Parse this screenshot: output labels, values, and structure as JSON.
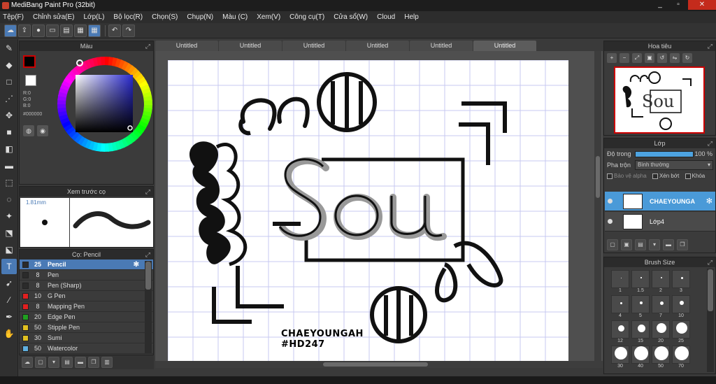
{
  "window": {
    "title": "MediBang Paint Pro (32bit)",
    "min": "_",
    "max": "▫",
    "close": "✕"
  },
  "menu": [
    "Tệp(F)",
    "Chỉnh sửa(E)",
    "Lớp(L)",
    "Bộ lọc(R)",
    "Chọn(S)",
    "Chụp(N)",
    "Màu (C)",
    "Xem(V)",
    "Công cụ(T)",
    "Cửa sổ(W)",
    "Cloud",
    "Help"
  ],
  "toolbar_icons": [
    "cloud-icon",
    "export-icon",
    "chat-icon",
    "comment-icon",
    "page-icon",
    "grid-icon",
    "grid-active-icon",
    "undo-icon",
    "redo-icon"
  ],
  "tools": [
    "brush-icon",
    "eraser-icon",
    "rectangle-icon",
    "dotbrush-icon",
    "move-icon",
    "fill-rect-icon",
    "bucket-icon",
    "gradient-icon",
    "select-rect-icon",
    "lasso-icon",
    "wand-icon",
    "selpen-icon",
    "selerase-icon",
    "text-icon",
    "operation-icon",
    "eyedropper-icon",
    "pen-icon",
    "hand-icon"
  ],
  "color_panel": {
    "title": "Màu",
    "r": "R:0",
    "g": "G:0",
    "b": "B:0",
    "hex": "#000000",
    "main_color": "#000000",
    "accent_border": "#cc0000"
  },
  "preview_panel": {
    "title": "Xem trước cọ",
    "size": "1.81mm"
  },
  "brush_panel": {
    "title": "Cọ: Pencil",
    "brushes": [
      {
        "size": "25",
        "name": "Pencil",
        "color": "#2b2b2b",
        "selected": true
      },
      {
        "size": "8",
        "name": "Pen",
        "color": "#2b2b2b",
        "selected": false
      },
      {
        "size": "8",
        "name": "Pen (Sharp)",
        "color": "#2b2b2b",
        "selected": false
      },
      {
        "size": "10",
        "name": "G Pen",
        "color": "#e02020",
        "selected": false
      },
      {
        "size": "8",
        "name": "Mapping Pen",
        "color": "#e02020",
        "selected": false
      },
      {
        "size": "20",
        "name": "Edge Pen",
        "color": "#20a020",
        "selected": false
      },
      {
        "size": "50",
        "name": "Stipple Pen",
        "color": "#e0c020",
        "selected": false
      },
      {
        "size": "30",
        "name": "Sumi",
        "color": "#e0c020",
        "selected": false
      },
      {
        "size": "50",
        "name": "Watercolor",
        "color": "#60b0e0",
        "selected": false
      }
    ]
  },
  "tabs": [
    "Untitled",
    "Untitled",
    "Untitled",
    "Untitled",
    "Untitled",
    "Untitled"
  ],
  "active_tab": 5,
  "canvas": {
    "signature_line1": "CHAEYOUNGAH",
    "signature_line2": "#HD247"
  },
  "navigator": {
    "title": "Hoa tiêu",
    "thumb_text": "Sou"
  },
  "layer_panel": {
    "title": "Lớp",
    "opacity_label": "Độ trong",
    "opacity_value": "100 %",
    "opacity": 1.0,
    "blend_label": "Pha trộn",
    "blend_value": "Bình thường",
    "protect_alpha": "Bảo vệ alpha",
    "clipping": "Xén bớt",
    "lock": "Khóa",
    "layers": [
      {
        "name": "CHAEYOUNGA",
        "selected": true
      },
      {
        "name": "Lớp4",
        "selected": false
      }
    ]
  },
  "brush_size_panel": {
    "title": "Brush Size",
    "sizes": [
      "1",
      "1.5",
      "2",
      "3",
      "4",
      "5",
      "7",
      "10",
      "12",
      "15",
      "20",
      "25",
      "30",
      "40",
      "50",
      "70"
    ]
  }
}
